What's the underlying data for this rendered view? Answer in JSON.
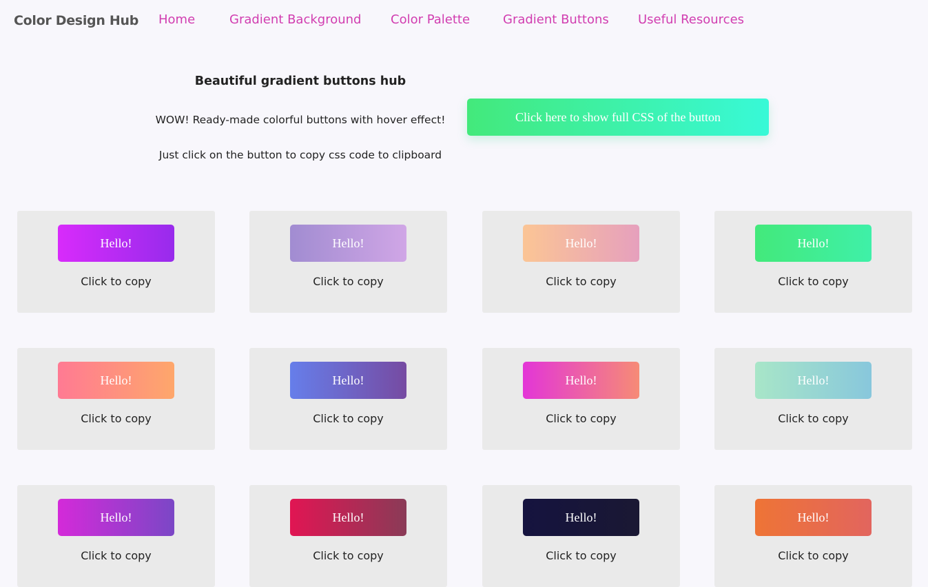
{
  "nav": {
    "brand": "Color Design Hub",
    "links": [
      "Home",
      "Gradient Background",
      "Color Palette",
      "Gradient Buttons",
      "Useful Resources"
    ],
    "link_color": "#d13db0"
  },
  "hero": {
    "title": "Beautiful gradient buttons hub",
    "line1": "WOW! Ready-made colorful buttons with hover effect!",
    "line2": "Just click on the button to copy css code to clipboard",
    "show_css_label": "Click here to show full CSS of the button"
  },
  "cards": [
    {
      "label": "Hello!",
      "caption": "Click to copy",
      "from": "#d82bfb",
      "to": "#982bec"
    },
    {
      "label": "Hello!",
      "caption": "Click to copy",
      "from": "#a18cd1",
      "to": "#d0a6e6"
    },
    {
      "label": "Hello!",
      "caption": "Click to copy",
      "from": "#fbc595",
      "to": "#e6a0bd"
    },
    {
      "label": "Hello!",
      "caption": "Click to copy",
      "from": "#43e97b",
      "to": "#3ff0a8"
    },
    {
      "label": "Hello!",
      "caption": "Click to copy",
      "from": "#ff7a93",
      "to": "#fea76b"
    },
    {
      "label": "Hello!",
      "caption": "Click to copy",
      "from": "#667eea",
      "to": "#764ba2"
    },
    {
      "label": "Hello!",
      "caption": "Click to copy",
      "from": "#e336d7",
      "to": "#f68b76"
    },
    {
      "label": "Hello!",
      "caption": "Click to copy",
      "from": "#a8e6c8",
      "to": "#88c7dc"
    },
    {
      "label": "Hello!",
      "caption": "Click to copy",
      "from": "#d42ad9",
      "to": "#7b47c6"
    },
    {
      "label": "Hello!",
      "caption": "Click to copy",
      "from": "#e11553",
      "to": "#8a3b57"
    },
    {
      "label": "Hello!",
      "caption": "Click to copy",
      "from": "#15133f",
      "to": "#1a1833"
    },
    {
      "label": "Hello!",
      "caption": "Click to copy",
      "from": "#ee7436",
      "to": "#e2655e"
    }
  ]
}
